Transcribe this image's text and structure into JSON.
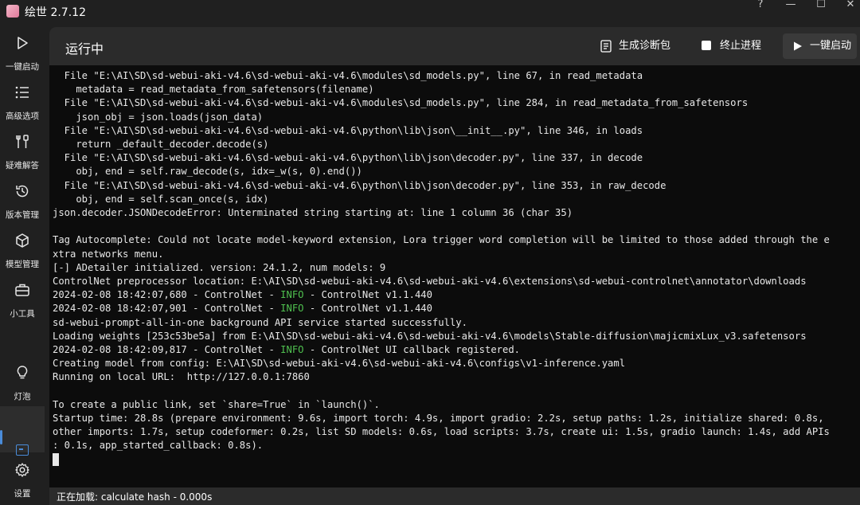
{
  "app": {
    "title": "绘世 2.7.12"
  },
  "window_controls": {
    "help": "?",
    "minimize": "—",
    "maximize": "☐",
    "close": "✕"
  },
  "sidebar": {
    "items": [
      {
        "label": "一键启动",
        "icon": "play-icon"
      },
      {
        "label": "高级选项",
        "icon": "list-icon"
      },
      {
        "label": "疑难解答",
        "icon": "tools-icon"
      },
      {
        "label": "版本管理",
        "icon": "history-icon"
      },
      {
        "label": "模型管理",
        "icon": "cube-icon"
      },
      {
        "label": "小工具",
        "icon": "toolbox-icon"
      }
    ],
    "bottom_items": [
      {
        "label": "灯泡",
        "icon": "lightbulb-icon"
      },
      {
        "label": "",
        "icon": "terminal-icon"
      },
      {
        "label": "设置",
        "icon": "gear-icon"
      }
    ]
  },
  "header": {
    "title": "运行中",
    "diag_label": "生成诊断包",
    "stop_label": "终止进程",
    "launch_label": "一键启动"
  },
  "console": {
    "lines": [
      "  File \"E:\\AI\\SD\\sd-webui-aki-v4.6\\sd-webui-aki-v4.6\\modules\\sd_models.py\", line 67, in read_metadata",
      "    metadata = read_metadata_from_safetensors(filename)",
      "  File \"E:\\AI\\SD\\sd-webui-aki-v4.6\\sd-webui-aki-v4.6\\modules\\sd_models.py\", line 284, in read_metadata_from_safetensors",
      "    json_obj = json.loads(json_data)",
      "  File \"E:\\AI\\SD\\sd-webui-aki-v4.6\\sd-webui-aki-v4.6\\python\\lib\\json\\__init__.py\", line 346, in loads",
      "    return _default_decoder.decode(s)",
      "  File \"E:\\AI\\SD\\sd-webui-aki-v4.6\\sd-webui-aki-v4.6\\python\\lib\\json\\decoder.py\", line 337, in decode",
      "    obj, end = self.raw_decode(s, idx=_w(s, 0).end())",
      "  File \"E:\\AI\\SD\\sd-webui-aki-v4.6\\sd-webui-aki-v4.6\\python\\lib\\json\\decoder.py\", line 353, in raw_decode",
      "    obj, end = self.scan_once(s, idx)",
      "json.decoder.JSONDecodeError: Unterminated string starting at: line 1 column 36 (char 35)",
      "",
      "Tag Autocomplete: Could not locate model-keyword extension, Lora trigger word completion will be limited to those added through the e",
      "xtra networks menu.",
      "[-] ADetailer initialized. version: 24.1.2, num models: 9",
      "ControlNet preprocessor location: E:\\AI\\SD\\sd-webui-aki-v4.6\\sd-webui-aki-v4.6\\extensions\\sd-webui-controlnet\\annotator\\downloads",
      "2024-02-08 18:42:07,680 - ControlNet - INFO - ControlNet v1.1.440",
      "2024-02-08 18:42:07,901 - ControlNet - INFO - ControlNet v1.1.440",
      "sd-webui-prompt-all-in-one background API service started successfully.",
      "Loading weights [253c53be5a] from E:\\AI\\SD\\sd-webui-aki-v4.6\\sd-webui-aki-v4.6\\models\\Stable-diffusion\\majicmixLux_v3.safetensors",
      "2024-02-08 18:42:09,817 - ControlNet - INFO - ControlNet UI callback registered.",
      "Creating model from config: E:\\AI\\SD\\sd-webui-aki-v4.6\\sd-webui-aki-v4.6\\configs\\v1-inference.yaml",
      "Running on local URL:  http://127.0.0.1:7860",
      "",
      "To create a public link, set `share=True` in `launch()`.",
      "Startup time: 28.8s (prepare environment: 9.6s, import torch: 4.9s, import gradio: 2.2s, setup paths: 1.2s, initialize shared: 0.8s,",
      "other imports: 1.7s, setup codeformer: 0.2s, list SD models: 0.6s, load scripts: 3.7s, create ui: 1.5s, gradio launch: 1.4s, add APIs",
      ": 0.1s, app_started_callback: 0.8s)."
    ]
  },
  "status": {
    "text": "正在加载: calculate hash - 0.000s"
  },
  "colors": {
    "info": "#4fc04f",
    "accent": "#4a8cd9",
    "background": "#0c0c0c"
  }
}
